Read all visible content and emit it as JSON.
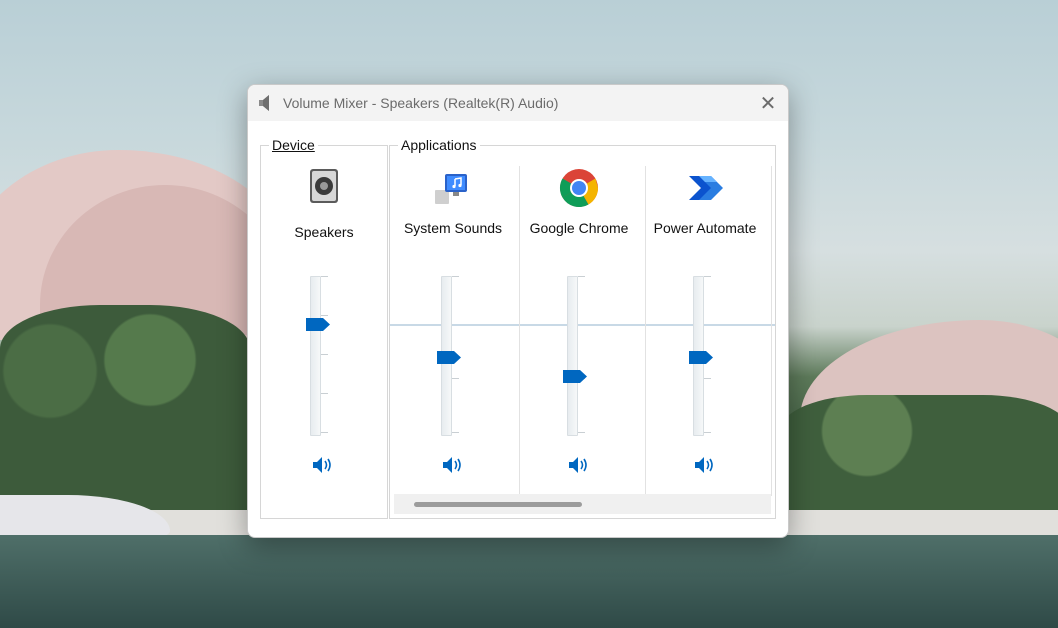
{
  "window": {
    "title": "Volume Mixer - Speakers (Realtek(R) Audio)",
    "close_glyph": "✕"
  },
  "device": {
    "group_label": "Device",
    "channel": {
      "label": "Speakers",
      "icon": "speaker-icon",
      "volume_fraction": 0.69
    }
  },
  "applications": {
    "group_label": "Applications",
    "channels": [
      {
        "label": "System Sounds",
        "icon": "system-sounds-icon",
        "volume_fraction": 0.48
      },
      {
        "label": "Google Chrome",
        "icon": "chrome-icon",
        "volume_fraction": 0.36
      },
      {
        "label": "Power Automate",
        "icon": "power-automate-icon",
        "volume_fraction": 0.48
      }
    ]
  },
  "colors": {
    "accent": "#0067c0",
    "title_text": "#6b6b6b"
  }
}
